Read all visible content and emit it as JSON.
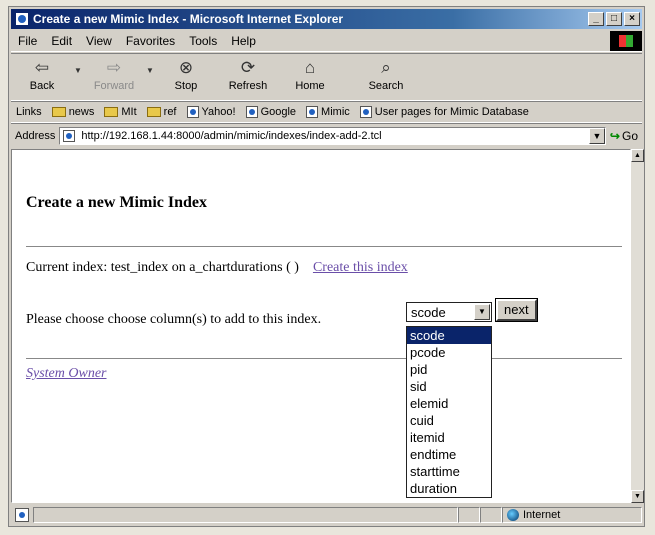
{
  "window": {
    "title": "Create a new Mimic Index - Microsoft Internet Explorer"
  },
  "menu": [
    "File",
    "Edit",
    "View",
    "Favorites",
    "Tools",
    "Help"
  ],
  "toolbar": {
    "back": "Back",
    "forward": "Forward",
    "stop": "Stop",
    "refresh": "Refresh",
    "home": "Home",
    "search": "Search"
  },
  "links": {
    "label": "Links",
    "items": [
      "news",
      "MIt",
      "ref",
      "Yahoo!",
      "Google",
      "Mimic",
      "User pages for Mimic Database"
    ]
  },
  "address": {
    "label": "Address",
    "url": "http://192.168.1.44:8000/admin/mimic/indexes/index-add-2.tcl",
    "go": "Go"
  },
  "page": {
    "heading": "Create a new Mimic Index",
    "current_index": "Current index: test_index on a_chartdurations ( )",
    "create_link": "Create this index",
    "choose_prompt": "Please choose choose column(s) to add to this index.",
    "select_value": "scode",
    "next_button": "next",
    "owner_link": "System Owner",
    "options": [
      "scode",
      "pcode",
      "pid",
      "sid",
      "elemid",
      "cuid",
      "itemid",
      "endtime",
      "starttime",
      "duration"
    ]
  },
  "status": {
    "zone": "Internet"
  },
  "colors": {
    "titlebar": "#0a246a",
    "visited_link": "#6a4ea8",
    "highlight": "#0a246a"
  }
}
